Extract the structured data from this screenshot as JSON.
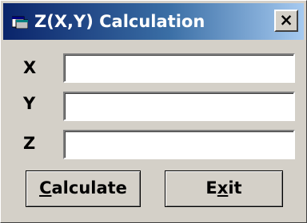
{
  "window": {
    "title": "Z(X,Y) Calculation",
    "close_label": "×"
  },
  "fields": [
    {
      "label": "X",
      "value": ""
    },
    {
      "label": "Y",
      "value": ""
    },
    {
      "label": "Z",
      "value": ""
    }
  ],
  "buttons": {
    "calculate": {
      "mnemonic": "C",
      "rest": "alculate"
    },
    "exit": {
      "before": "E",
      "mnemonic": "x",
      "after": "it"
    }
  },
  "colors": {
    "face": "#d4d0c8",
    "title_gradient_start": "#0a246a",
    "title_gradient_end": "#a6caf0",
    "title_text": "#ffffff"
  },
  "icons": {
    "app": "window-app-icon",
    "close": "close-icon"
  }
}
